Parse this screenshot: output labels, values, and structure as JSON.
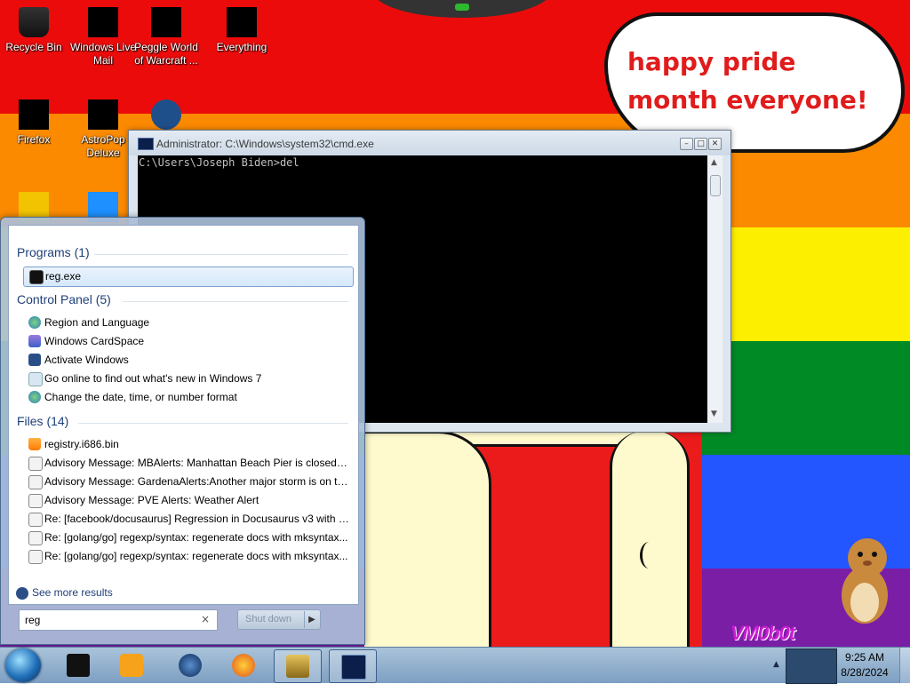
{
  "wallpaper": {
    "speech_bubble": "happy pride month everyone!",
    "corner_logo": "VM0b0t"
  },
  "desktop_icons": [
    {
      "label": "Recycle Bin"
    },
    {
      "label": "Windows Live Mail"
    },
    {
      "label": "Peggle World of Warcraft ..."
    },
    {
      "label": "Everything"
    },
    {
      "label": "Firefox"
    },
    {
      "label": "AstroPop Deluxe"
    }
  ],
  "cmd_window": {
    "title": "Administrator: C:\\Windows\\system32\\cmd.exe",
    "prompt_line": "C:\\Users\\Joseph Biden>del"
  },
  "start_menu": {
    "sections": {
      "programs": "Programs (1)",
      "control_panel": "Control Panel (5)",
      "files": "Files (14)"
    },
    "programs": [
      {
        "label": "reg.exe",
        "icon": "console-icon"
      }
    ],
    "control_panel": [
      {
        "label": "Region and Language",
        "icon": "globe-icon"
      },
      {
        "label": "Windows CardSpace",
        "icon": "cardspace-icon"
      },
      {
        "label": "Activate Windows",
        "icon": "key-icon"
      },
      {
        "label": "Go online to find out what's new in Windows 7",
        "icon": "page-icon"
      },
      {
        "label": "Change the date, time, or number format",
        "icon": "globe-icon"
      }
    ],
    "files": [
      {
        "label": "registry.i686.bin",
        "icon": "vlc-icon"
      },
      {
        "label": "Advisory Message: MBAlerts: Manhattan Beach Pier is closed d...",
        "icon": "mail-icon"
      },
      {
        "label": "Advisory Message: GardenaAlerts:Another major storm is on th...",
        "icon": "mail-icon"
      },
      {
        "label": "Advisory Message: PVE Alerts: Weather Alert",
        "icon": "mail-icon"
      },
      {
        "label": "Re: [facebook/docusaurus] Regression in Docusaurus v3 with re...",
        "icon": "mail-icon"
      },
      {
        "label": "Re: [golang/go] regexp/syntax: regenerate docs with mksyntax...",
        "icon": "mail-icon"
      },
      {
        "label": "Re: [golang/go] regexp/syntax: regenerate docs with mksyntax...",
        "icon": "mail-icon"
      }
    ],
    "see_more": "See more results",
    "search": {
      "value": "reg",
      "clear": "×"
    },
    "shutdown_label": "Shut down"
  },
  "taskbar": {
    "pinned": [
      "media-icon",
      "window-icon",
      "network-icon",
      "firefox-icon",
      "box-game-icon",
      "cmd-icon"
    ],
    "clock": {
      "time": "9:25 AM",
      "date": "8/28/2024"
    }
  }
}
